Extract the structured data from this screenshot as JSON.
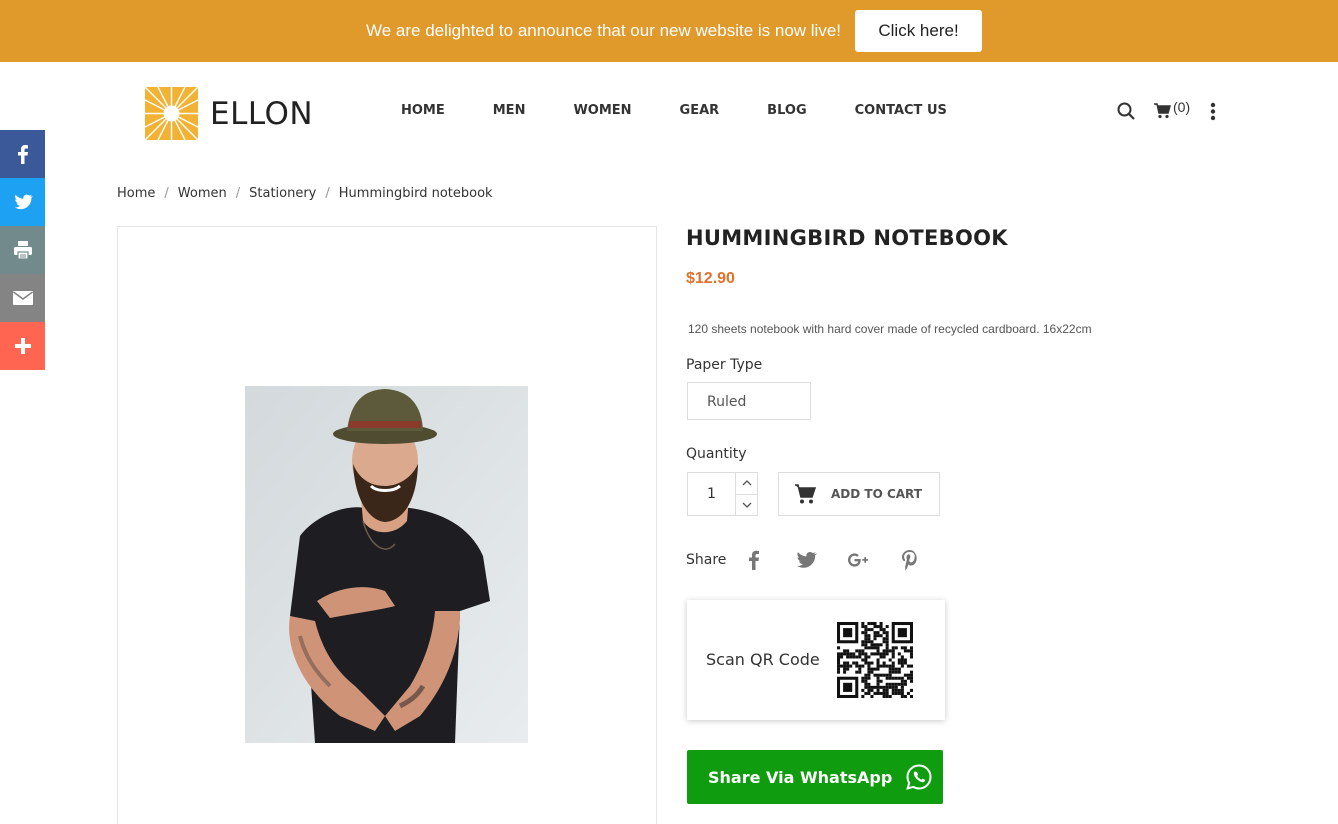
{
  "announcement": {
    "text": "We are delighted to announce that our new website is now live!",
    "button_label": "Click here!",
    "background": "#e0992b"
  },
  "header": {
    "logo_text": "ELLON",
    "nav": [
      "HOME",
      "MEN",
      "WOMEN",
      "GEAR",
      "BLOG",
      "CONTACT US"
    ],
    "cart_count": "(0)",
    "icons": [
      "search-icon",
      "cart-icon",
      "kebab-menu-icon"
    ]
  },
  "social_sidebar": {
    "items": [
      {
        "name": "facebook",
        "icon": "facebook-icon",
        "color": "#3b5998"
      },
      {
        "name": "twitter",
        "icon": "twitter-icon",
        "color": "#1da1f2"
      },
      {
        "name": "print",
        "icon": "print-icon",
        "color": "#738a8d"
      },
      {
        "name": "email",
        "icon": "email-icon",
        "color": "#848484"
      },
      {
        "name": "more",
        "icon": "plus-icon",
        "color": "#ff6550"
      }
    ]
  },
  "breadcrumb": [
    "Home",
    "Women",
    "Stationery",
    "Hummingbird notebook"
  ],
  "product": {
    "title": "HUMMINGBIRD NOTEBOOK",
    "price": "$12.90",
    "price_color": "#e0722b",
    "description": "120 sheets notebook with hard cover made of recycled cardboard. 16x22cm",
    "paper_type_label": "Paper Type",
    "paper_type_value": "Ruled",
    "quantity_label": "Quantity",
    "quantity_value": "1",
    "add_to_cart_label": "ADD TO CART",
    "share_label": "Share",
    "share_icons": [
      "facebook-icon",
      "twitter-icon",
      "google-plus-icon",
      "pinterest-icon"
    ],
    "qr_label": "Scan QR Code",
    "whatsapp_label": "Share Via WhatsApp",
    "whatsapp_color": "#0f9d0f"
  }
}
